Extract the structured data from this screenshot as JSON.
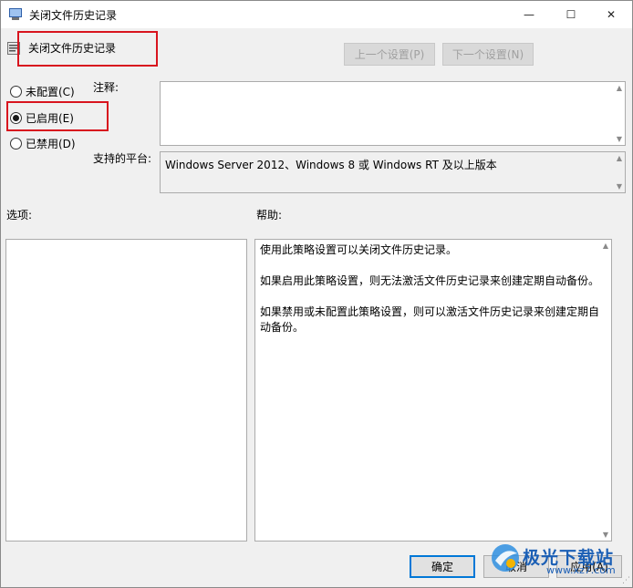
{
  "window": {
    "title": "关闭文件历史记录",
    "minimize_glyph": "—",
    "maximize_glyph": "☐",
    "close_glyph": "✕"
  },
  "policy": {
    "name": "关闭文件历史记录",
    "prev_setting": "上一个设置(P)",
    "next_setting": "下一个设置(N)"
  },
  "state": {
    "options": [
      {
        "label": "未配置(C)",
        "checked": false
      },
      {
        "label": "已启用(E)",
        "checked": true
      },
      {
        "label": "已禁用(D)",
        "checked": false
      }
    ]
  },
  "labels": {
    "comment": "注释:",
    "supported_on": "支持的平台:",
    "options": "选项:",
    "help": "帮助:"
  },
  "fields": {
    "comment_value": "",
    "supported_on_value": "Windows Server 2012、Windows 8 或 Windows RT 及以上版本"
  },
  "help": {
    "paragraphs": [
      "使用此策略设置可以关闭文件历史记录。",
      "如果启用此策略设置，则无法激活文件历史记录来创建定期自动备份。",
      "如果禁用或未配置此策略设置，则可以激活文件历史记录来创建定期自动备份。"
    ]
  },
  "buttons": {
    "ok": "确定",
    "cancel": "取消",
    "apply": "应用(A)"
  },
  "watermark": {
    "brand": "极光下载站",
    "url": "www.xz7.com"
  },
  "colors": {
    "highlight": "#d8141e",
    "focus": "#0078d7",
    "watermark": "#1b5fb5"
  },
  "icons": [
    "policy-app-icon",
    "policy-setting-icon",
    "minimize-icon",
    "maximize-icon",
    "close-icon",
    "scroll-up-icon",
    "scroll-down-icon",
    "watermark-logo-icon"
  ]
}
